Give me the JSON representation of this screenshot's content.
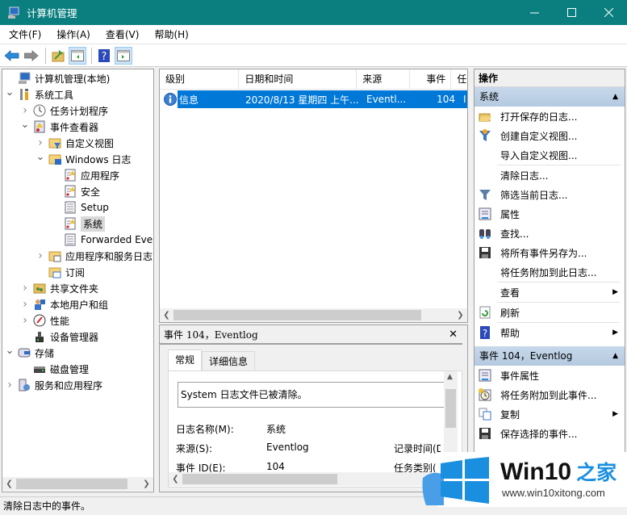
{
  "window": {
    "title": "计算机管理",
    "icon": "computer-management-icon",
    "controls": [
      "minimize",
      "maximize",
      "close"
    ]
  },
  "menu": [
    "文件(F)",
    "操作(A)",
    "查看(V)",
    "帮助(H)"
  ],
  "toolbar": {
    "buttons": [
      "back-icon",
      "forward-icon",
      "up-folder-icon",
      "show-hide-console-tree-icon",
      "help-icon",
      "show-hide-action-pane-icon"
    ]
  },
  "tree": {
    "items": [
      {
        "label": "计算机管理(本地)",
        "level": 0,
        "expand": "",
        "icon": "computer-icon"
      },
      {
        "label": "系统工具",
        "level": 0,
        "expand": "open",
        "icon": "tools-icon"
      },
      {
        "label": "任务计划程序",
        "level": 1,
        "expand": "closed",
        "icon": "clock-icon"
      },
      {
        "label": "事件查看器",
        "level": 1,
        "expand": "open",
        "icon": "event-viewer-icon"
      },
      {
        "label": "自定义视图",
        "level": 2,
        "expand": "closed",
        "icon": "filter-folder-icon"
      },
      {
        "label": "Windows 日志",
        "level": 2,
        "expand": "open",
        "icon": "windows-logs-folder-icon"
      },
      {
        "label": "应用程序",
        "level": 3,
        "expand": "",
        "icon": "log-warning-icon"
      },
      {
        "label": "安全",
        "level": 3,
        "expand": "",
        "icon": "log-warning-icon"
      },
      {
        "label": "Setup",
        "level": 3,
        "expand": "",
        "icon": "log-icon"
      },
      {
        "label": "系统",
        "level": 3,
        "expand": "",
        "icon": "log-warning-icon",
        "selected": true
      },
      {
        "label": "Forwarded Eve",
        "level": 3,
        "expand": "",
        "icon": "log-icon"
      },
      {
        "label": "应用程序和服务日志",
        "level": 2,
        "expand": "closed",
        "icon": "folder-icon"
      },
      {
        "label": "订阅",
        "level": 2,
        "expand": "",
        "icon": "subscription-icon"
      },
      {
        "label": "共享文件夹",
        "level": 1,
        "expand": "closed",
        "icon": "shared-folder-icon"
      },
      {
        "label": "本地用户和组",
        "level": 1,
        "expand": "closed",
        "icon": "users-icon"
      },
      {
        "label": "性能",
        "level": 1,
        "expand": "closed",
        "icon": "performance-icon"
      },
      {
        "label": "设备管理器",
        "level": 1,
        "expand": "",
        "icon": "device-manager-icon"
      },
      {
        "label": "存储",
        "level": 0,
        "expand": "open",
        "icon": "storage-icon"
      },
      {
        "label": "磁盘管理",
        "level": 1,
        "expand": "",
        "icon": "disk-icon"
      },
      {
        "label": "服务和应用程序",
        "level": 0,
        "expand": "closed",
        "icon": "services-icon"
      }
    ]
  },
  "event_list": {
    "columns": [
      "级别",
      "日期和时间",
      "来源",
      "事件 ID",
      "任"
    ],
    "rows": [
      {
        "level": "信息",
        "datetime": "2020/8/13 星期四 上午...",
        "source": "Eventl...",
        "event_id": "104",
        "task": "I"
      }
    ]
  },
  "event_detail": {
    "header": "事件 104，Eventlog",
    "tabs": [
      "常规",
      "详细信息"
    ],
    "active_tab": "常规",
    "message": "System 日志文件已被清除。",
    "fields": [
      {
        "label": "日志名称(M):",
        "value": "系统"
      },
      {
        "label": "来源(S):",
        "value": "Eventlog"
      },
      {
        "label": "事件 ID(E):",
        "value": "104"
      }
    ],
    "right_labels": [
      "记录时间(D",
      "任务类别("
    ]
  },
  "actions": {
    "header": "操作",
    "sections": [
      {
        "title": "系统",
        "items": [
          {
            "label": "打开保存的日志...",
            "icon": "open-folder-icon"
          },
          {
            "label": "创建自定义视图...",
            "icon": "filter-create-icon"
          },
          {
            "label": "导入自定义视图...",
            "icon": ""
          },
          {
            "sep": true
          },
          {
            "label": "清除日志...",
            "icon": ""
          },
          {
            "label": "筛选当前日志...",
            "icon": "filter-icon"
          },
          {
            "label": "属性",
            "icon": "properties-icon"
          },
          {
            "label": "查找...",
            "icon": "binoculars-icon"
          },
          {
            "label": "将所有事件另存为...",
            "icon": "save-icon"
          },
          {
            "label": "将任务附加到此日志...",
            "icon": ""
          },
          {
            "sep": true
          },
          {
            "label": "查看",
            "icon": "",
            "submenu": true
          },
          {
            "sep": true
          },
          {
            "label": "刷新",
            "icon": "refresh-icon"
          },
          {
            "sep": true
          },
          {
            "label": "帮助",
            "icon": "help-icon",
            "submenu": true
          }
        ]
      },
      {
        "title": "事件 104，Eventlog",
        "items": [
          {
            "label": "事件属性",
            "icon": "properties-icon"
          },
          {
            "label": "将任务附加到此事件...",
            "icon": "task-clock-icon"
          },
          {
            "label": "复制",
            "icon": "copy-icon",
            "submenu": true
          },
          {
            "label": "保存选择的事件...",
            "icon": "save-icon"
          }
        ]
      }
    ]
  },
  "status_bar": "清除日志中的事件。",
  "watermark": {
    "brand": "Win10",
    "brand_suffix": "之家",
    "url": "www.win10xitong.com"
  },
  "colors": {
    "titlebar": "#0b7f80",
    "selection": "#0078d7",
    "action_section": "#bcd0e5",
    "watermark_blue": "#1a8fe0"
  }
}
